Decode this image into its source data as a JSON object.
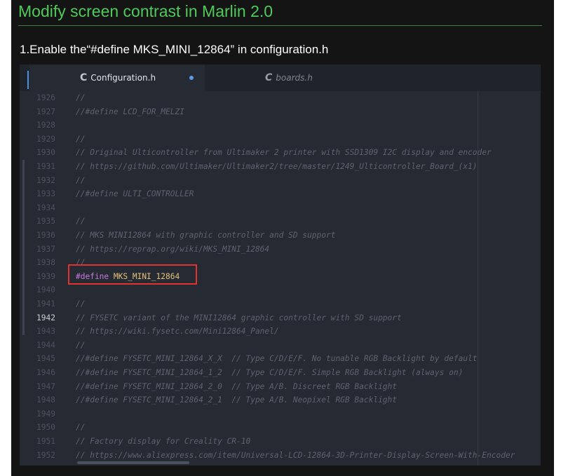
{
  "title": "Modify screen contrast in Marlin 2.0",
  "step": "1.Enable the“#define MKS_MINI_12864” in configuration.h",
  "editor": {
    "tabs": [
      {
        "icon": "C",
        "label": "Configuration.h",
        "active": true
      },
      {
        "icon": "C",
        "label": "boards.h",
        "active": false
      }
    ],
    "current_line": "1942",
    "lines": [
      {
        "num": "1926",
        "text": "//"
      },
      {
        "num": "1927",
        "text": "//#define LCD_FOR_MELZI"
      },
      {
        "num": "1928",
        "text": ""
      },
      {
        "num": "1929",
        "text": "//"
      },
      {
        "num": "1930",
        "text": "// Original Ulticontroller from Ultimaker 2 printer with SSD1309 I2C display and encoder"
      },
      {
        "num": "1931",
        "text": "// https://github.com/Ultimaker/Ultimaker2/tree/master/1249_Ulticontroller_Board_(x1)"
      },
      {
        "num": "1932",
        "text": "//"
      },
      {
        "num": "1933",
        "text": "//#define ULTI_CONTROLLER"
      },
      {
        "num": "1934",
        "text": ""
      },
      {
        "num": "1935",
        "text": "//"
      },
      {
        "num": "1936",
        "text": "// MKS MINI12864 with graphic controller and SD support"
      },
      {
        "num": "1937",
        "text": "// https://reprap.org/wiki/MKS_MINI_12864"
      },
      {
        "num": "1938",
        "text": "//"
      },
      {
        "num": "1939",
        "keyword": "#define",
        "macro": "MKS_MINI_12864"
      },
      {
        "num": "1940",
        "text": ""
      },
      {
        "num": "1941",
        "text": "//"
      },
      {
        "num": "1942",
        "text": "// FYSETC variant of the MINI12864 graphic controller with SD support"
      },
      {
        "num": "1943",
        "text": "// https://wiki.fysetc.com/Mini12864_Panel/"
      },
      {
        "num": "1944",
        "text": "//"
      },
      {
        "num": "1945",
        "text": "//#define FYSETC_MINI_12864_X_X  // Type C/D/E/F. No tunable RGB Backlight by default"
      },
      {
        "num": "1946",
        "text": "//#define FYSETC_MINI_12864_1_2  // Type C/D/E/F. Simple RGB Backlight (always on)"
      },
      {
        "num": "1947",
        "text": "//#define FYSETC_MINI_12864_2_0  // Type A/B. Discreet RGB Backlight"
      },
      {
        "num": "1948",
        "text": "//#define FYSETC_MINI_12864_2_1  // Type A/B. Neopixel RGB Backlight"
      },
      {
        "num": "1949",
        "text": ""
      },
      {
        "num": "1950",
        "text": "//"
      },
      {
        "num": "1951",
        "text": "// Factory display for Creality CR-10"
      },
      {
        "num": "1952",
        "text": "// https://www.aliexpress.com/item/Universal-LCD-12864-3D-Printer-Display-Screen-With-Encoder"
      }
    ]
  },
  "colors": {
    "title": "#4fca5a",
    "background": "#141414",
    "editor_bg": "#262a33",
    "comment": "#5c6370",
    "keyword": "#c678dd",
    "macro": "#e5c07b",
    "highlight_box": "#e0322f"
  }
}
